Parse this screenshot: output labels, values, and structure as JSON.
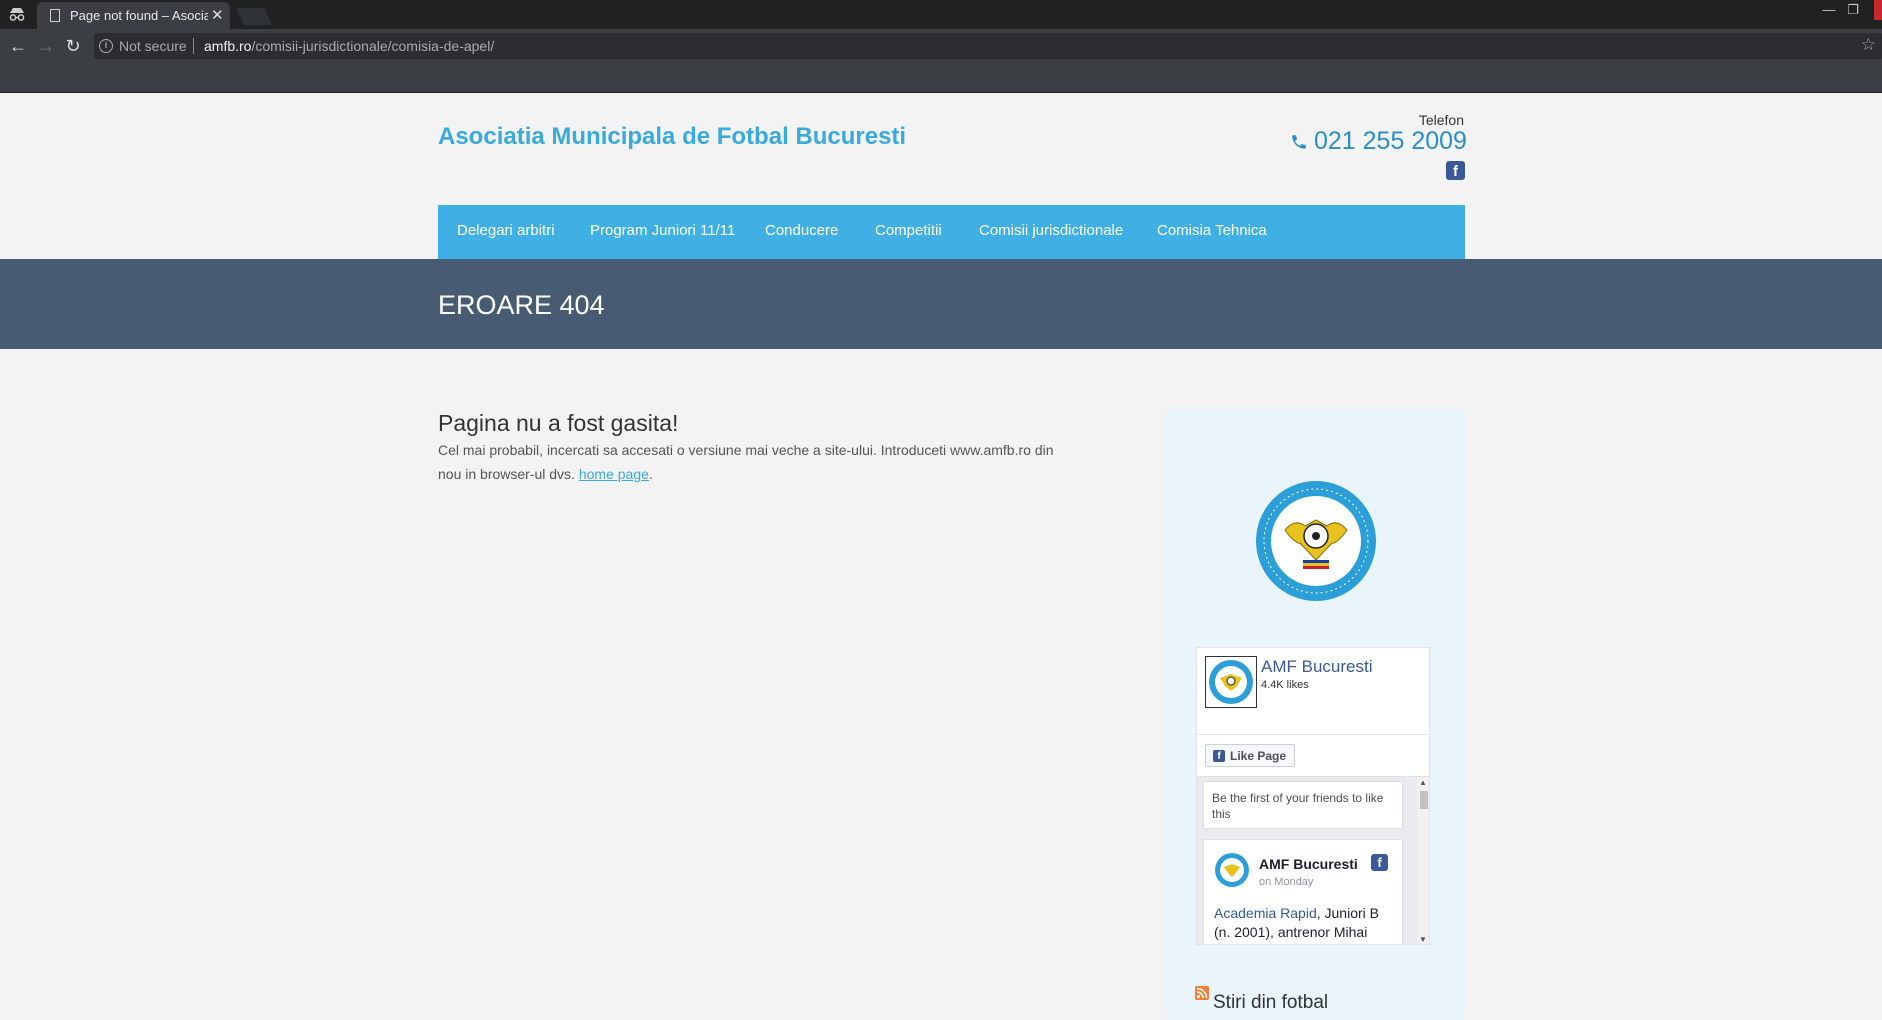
{
  "browser": {
    "tab_title": "Page not found – Asociatia Municipala",
    "not_secure": "Not secure",
    "url_domain": "amfb.ro",
    "url_path": "/comisii-jurisdictionale/comisia-de-apel/"
  },
  "header": {
    "site_title": "Asociatia Municipala de Fotbal Bucuresti",
    "phone_label": "Telefon",
    "phone_number": "021 255 2009",
    "fb_letter": "f"
  },
  "nav": {
    "items": [
      "Delegari arbitri",
      "Program Juniori 11/11",
      "Conducere",
      "Competitii",
      "Comisii jurisdictionale",
      "Comisia Tehnica"
    ]
  },
  "banner": {
    "title": "EROARE 404"
  },
  "content": {
    "title": "Pagina nu a fost gasita!",
    "text_before_link": "Cel mai probabil, incercati sa accesati o versiune mai veche a site-ului. Introduceti www.amfb.ro din nou in browser-ul dvs. ",
    "link_text": "home page",
    "text_after_link": "."
  },
  "sidebar": {
    "fb_widget": {
      "page_name": "AMF Bucuresti",
      "likes": "4.4K likes",
      "like_button": "Like Page",
      "friends_text": "Be the first of your friends to like this",
      "post_author": "AMF Bucuresti",
      "post_time": "on Monday",
      "post_link": "Academia Rapid",
      "post_text": ", Juniori B (n. 2001), antrenor Mihai"
    },
    "rss_title": "Stiri din fotbal"
  },
  "colors": {
    "accent": "#40b0e4",
    "banner": "#475c73",
    "title": "#3aa9dd",
    "facebook": "#3b5998"
  }
}
